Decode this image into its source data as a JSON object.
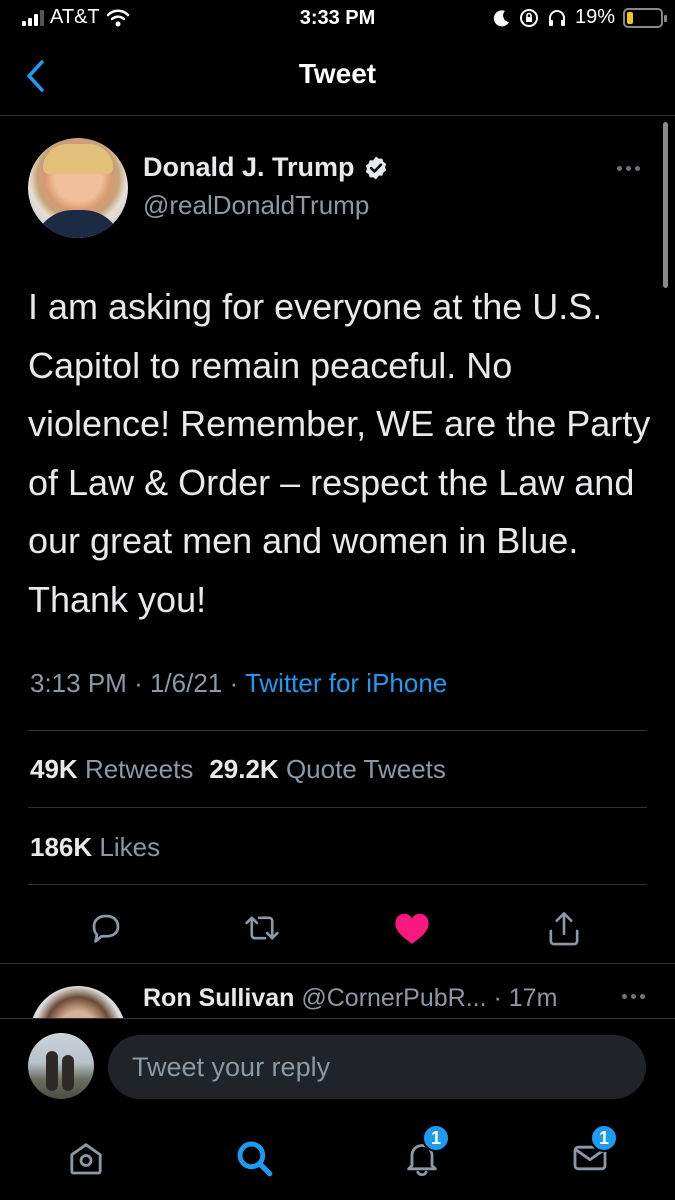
{
  "status_bar": {
    "carrier": "AT&T",
    "time": "3:33 PM",
    "battery_percent": "19%",
    "battery_level": 0.19,
    "icons": [
      "signal-icon",
      "wifi-icon",
      "moon-icon",
      "lock-rotation-icon",
      "headphones-icon",
      "battery-charging-icon"
    ]
  },
  "header": {
    "title": "Tweet",
    "back_icon": "chevron-left-icon"
  },
  "tweet": {
    "display_name": "Donald J. Trump",
    "handle": "@realDonaldTrump",
    "text": "I am asking for everyone at the U.S. Capitol to remain peaceful. No violence! Remember, WE are the Party of Law & Order – respect the Law and our great men and women in Blue. Thank you!",
    "time": "3:13 PM",
    "date": "1/6/21",
    "separator": "·",
    "source": "Twitter for iPhone",
    "retweets_count": "49K",
    "retweets_label": "Retweets",
    "quote_count": "29.2K",
    "quote_label": "Quote Tweets",
    "likes_count": "186K",
    "likes_label": "Likes"
  },
  "actions": {
    "icons": [
      "reply-icon",
      "retweet-icon",
      "heart-icon",
      "share-icon"
    ],
    "liked": true,
    "like_color": "#f91880"
  },
  "reply_preview": {
    "name": "Ron Sullivan",
    "handle": "@CornerPubR...",
    "time": "· 17m"
  },
  "composer": {
    "placeholder": "Tweet your reply"
  },
  "tabbar": {
    "tabs": [
      {
        "icon": "home-icon",
        "badge": ""
      },
      {
        "icon": "search-icon",
        "badge": "",
        "active": true
      },
      {
        "icon": "notifications-bell-icon",
        "badge": "1"
      },
      {
        "icon": "messages-envelope-icon",
        "badge": "1"
      }
    ]
  },
  "colors": {
    "accent": "#1d9bf0",
    "background": "#000000",
    "secondary_text": "#8b98a5",
    "like": "#f91880"
  }
}
